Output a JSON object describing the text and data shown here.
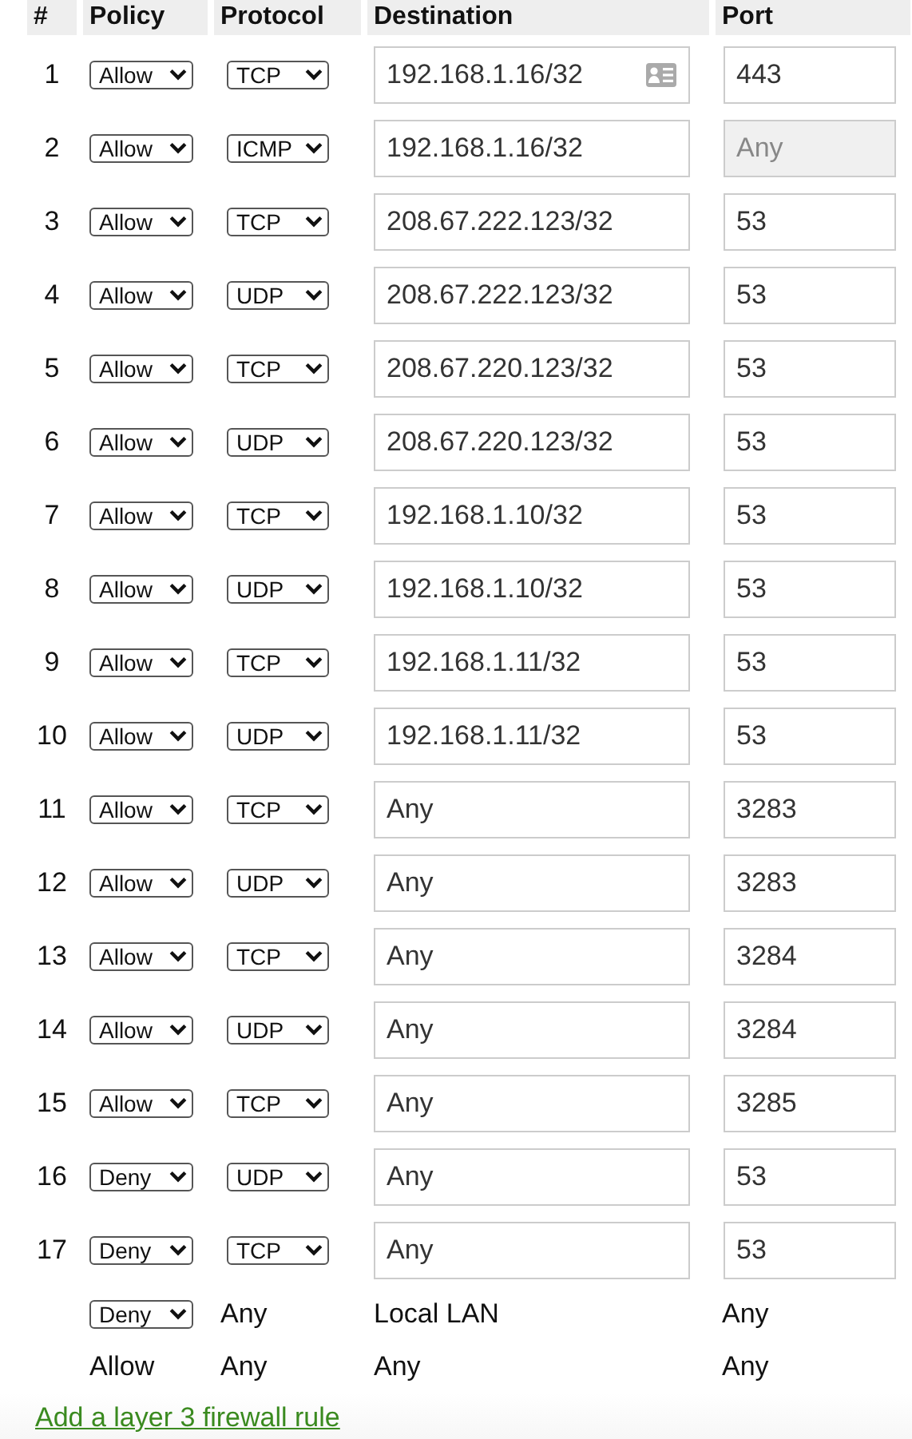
{
  "table": {
    "columns": [
      "#",
      "Policy",
      "Protocol",
      "Destination",
      "Port"
    ],
    "rules": [
      {
        "number": "1",
        "policy": "Allow",
        "protocol": "TCP",
        "destination": "192.168.1.16/32",
        "port": "443",
        "port_disabled": false,
        "address_icon": true
      },
      {
        "number": "2",
        "policy": "Allow",
        "protocol": "ICMP",
        "destination": "192.168.1.16/32",
        "port": "Any",
        "port_disabled": true,
        "address_icon": false
      },
      {
        "number": "3",
        "policy": "Allow",
        "protocol": "TCP",
        "destination": "208.67.222.123/32",
        "port": "53",
        "port_disabled": false,
        "address_icon": false
      },
      {
        "number": "4",
        "policy": "Allow",
        "protocol": "UDP",
        "destination": "208.67.222.123/32",
        "port": "53",
        "port_disabled": false,
        "address_icon": false
      },
      {
        "number": "5",
        "policy": "Allow",
        "protocol": "TCP",
        "destination": "208.67.220.123/32",
        "port": "53",
        "port_disabled": false,
        "address_icon": false
      },
      {
        "number": "6",
        "policy": "Allow",
        "protocol": "UDP",
        "destination": "208.67.220.123/32",
        "port": "53",
        "port_disabled": false,
        "address_icon": false
      },
      {
        "number": "7",
        "policy": "Allow",
        "protocol": "TCP",
        "destination": "192.168.1.10/32",
        "port": "53",
        "port_disabled": false,
        "address_icon": false
      },
      {
        "number": "8",
        "policy": "Allow",
        "protocol": "UDP",
        "destination": "192.168.1.10/32",
        "port": "53",
        "port_disabled": false,
        "address_icon": false
      },
      {
        "number": "9",
        "policy": "Allow",
        "protocol": "TCP",
        "destination": "192.168.1.11/32",
        "port": "53",
        "port_disabled": false,
        "address_icon": false
      },
      {
        "number": "10",
        "policy": "Allow",
        "protocol": "UDP",
        "destination": "192.168.1.11/32",
        "port": "53",
        "port_disabled": false,
        "address_icon": false
      },
      {
        "number": "11",
        "policy": "Allow",
        "protocol": "TCP",
        "destination": "Any",
        "port": "3283",
        "port_disabled": false,
        "address_icon": false
      },
      {
        "number": "12",
        "policy": "Allow",
        "protocol": "UDP",
        "destination": "Any",
        "port": "3283",
        "port_disabled": false,
        "address_icon": false
      },
      {
        "number": "13",
        "policy": "Allow",
        "protocol": "TCP",
        "destination": "Any",
        "port": "3284",
        "port_disabled": false,
        "address_icon": false
      },
      {
        "number": "14",
        "policy": "Allow",
        "protocol": "UDP",
        "destination": "Any",
        "port": "3284",
        "port_disabled": false,
        "address_icon": false
      },
      {
        "number": "15",
        "policy": "Allow",
        "protocol": "TCP",
        "destination": "Any",
        "port": "3285",
        "port_disabled": false,
        "address_icon": false
      },
      {
        "number": "16",
        "policy": "Deny",
        "protocol": "UDP",
        "destination": "Any",
        "port": "53",
        "port_disabled": false,
        "address_icon": false
      },
      {
        "number": "17",
        "policy": "Deny",
        "protocol": "TCP",
        "destination": "Any",
        "port": "53",
        "port_disabled": false,
        "address_icon": false
      }
    ],
    "default_rules": [
      {
        "kind": "select",
        "policy": "Deny",
        "protocol": "Any",
        "destination": "Local LAN",
        "port": "Any"
      },
      {
        "kind": "text",
        "policy": "Allow",
        "protocol": "Any",
        "destination": "Any",
        "port": "Any"
      }
    ]
  },
  "add_rule_link": "Add a layer 3 firewall rule"
}
